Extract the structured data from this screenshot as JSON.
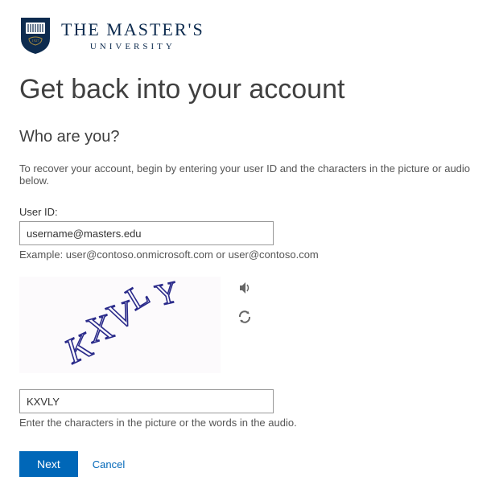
{
  "logo": {
    "main": "THE MASTER'S",
    "sub": "UNIVERSITY",
    "year": "1927"
  },
  "page": {
    "title": "Get back into your account",
    "subtitle": "Who are you?",
    "instruction": "To recover your account, begin by entering your user ID and the characters in the picture or audio below."
  },
  "userId": {
    "label": "User ID:",
    "value": "username@masters.edu",
    "example": "Example: user@contoso.onmicrosoft.com or user@contoso.com"
  },
  "captcha": {
    "imageText": "KXVLY",
    "inputValue": "KXVLY",
    "helper": "Enter the characters in the picture or the words in the audio."
  },
  "buttons": {
    "next": "Next",
    "cancel": "Cancel"
  },
  "colors": {
    "brandNavy": "#0d2b4f",
    "primary": "#0067b8"
  }
}
